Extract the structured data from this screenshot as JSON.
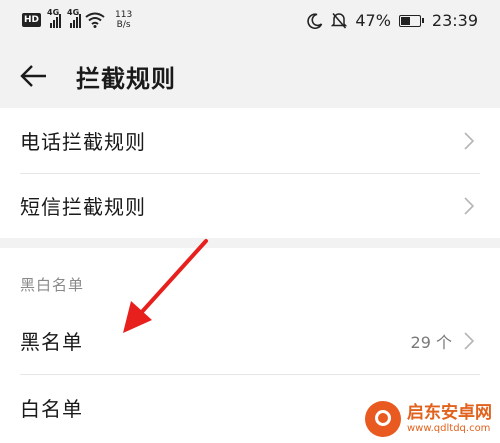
{
  "status_bar": {
    "network_tag_1": "4G",
    "network_tag_2": "4G",
    "net_speed_value": "113",
    "net_speed_unit": "B/s",
    "battery_percent": "47%",
    "battery_level": 0.47,
    "time": "23:39",
    "hd_label": "HD"
  },
  "header": {
    "title": "拦截规则"
  },
  "rules_section": {
    "items": [
      {
        "label": "电话拦截规则"
      },
      {
        "label": "短信拦截规则"
      }
    ]
  },
  "lists_section": {
    "title": "黑白名单",
    "items": [
      {
        "label": "黑名单",
        "count": "29 个"
      },
      {
        "label": "白名单"
      }
    ]
  },
  "watermark": {
    "name": "启东安卓网",
    "url": "www.qdltdq.com"
  },
  "colors": {
    "arrow": "#e8201d",
    "background": "#f2f2f2",
    "card": "#ffffff",
    "watermark": "#e0621d"
  }
}
